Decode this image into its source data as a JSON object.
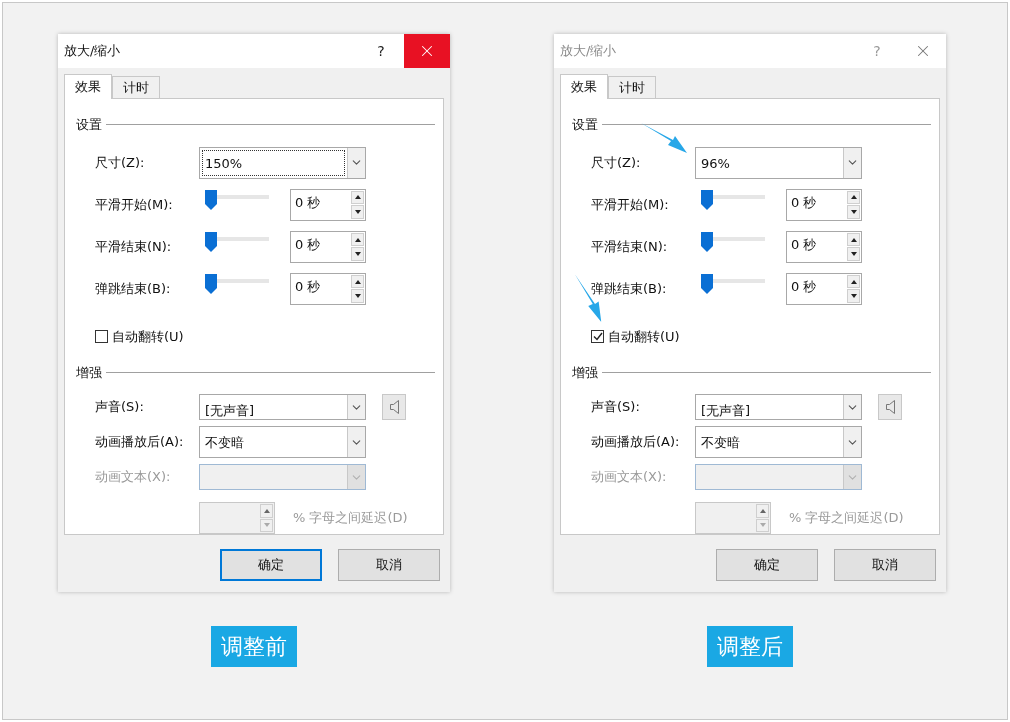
{
  "panels": [
    {
      "caption": "调整前",
      "dialog": {
        "title": "放大/缩小",
        "active": true,
        "help": "?",
        "tabs": [
          {
            "label": "效果",
            "selected": true
          },
          {
            "label": "计时",
            "selected": false
          }
        ],
        "settings": {
          "title": "设置",
          "size": {
            "label": "尺寸(Z):",
            "value": "150%",
            "focused": true,
            "highlighted": false
          },
          "timings": [
            {
              "label": "平滑开始(M):",
              "level": 0,
              "value": "0 秒"
            },
            {
              "label": "平滑结束(N):",
              "level": 0,
              "value": "0 秒"
            },
            {
              "label": "弹跳结束(B):",
              "level": 0,
              "value": "0 秒"
            }
          ],
          "auto_reverse": {
            "label": "自动翻转(U)",
            "checked": false,
            "highlighted": false
          }
        },
        "enhance": {
          "title": "增强",
          "sound": {
            "label": "声音(S):",
            "value": "[无声音]"
          },
          "after": {
            "label": "动画播放后(A):",
            "value": "不变暗"
          },
          "anim_text": {
            "label": "动画文本(X):",
            "disabled": true
          },
          "delay": {
            "label": "% 字母之间延迟(D)",
            "disabled": true
          }
        },
        "buttons": [
          {
            "label": "确定",
            "default": true
          },
          {
            "label": "取消",
            "default": false
          }
        ]
      }
    },
    {
      "caption": "调整后",
      "dialog": {
        "title": "放大/缩小",
        "active": false,
        "help": "?",
        "tabs": [
          {
            "label": "效果",
            "selected": true
          },
          {
            "label": "计时",
            "selected": false
          }
        ],
        "settings": {
          "title": "设置",
          "size": {
            "label": "尺寸(Z):",
            "value": "96%",
            "focused": false,
            "highlighted": true
          },
          "timings": [
            {
              "label": "平滑开始(M):",
              "level": 0,
              "value": "0 秒"
            },
            {
              "label": "平滑结束(N):",
              "level": 0,
              "value": "0 秒"
            },
            {
              "label": "弹跳结束(B):",
              "level": 0,
              "value": "0 秒"
            }
          ],
          "auto_reverse": {
            "label": "自动翻转(U)",
            "checked": true,
            "highlighted": true
          }
        },
        "enhance": {
          "title": "增强",
          "sound": {
            "label": "声音(S):",
            "value": "[无声音]"
          },
          "after": {
            "label": "动画播放后(A):",
            "value": "不变暗"
          },
          "anim_text": {
            "label": "动画文本(X):",
            "disabled": true
          },
          "delay": {
            "label": "% 字母之间延迟(D)",
            "disabled": true
          }
        },
        "buttons": [
          {
            "label": "确定",
            "default": false
          },
          {
            "label": "取消",
            "default": false
          }
        ]
      }
    }
  ]
}
